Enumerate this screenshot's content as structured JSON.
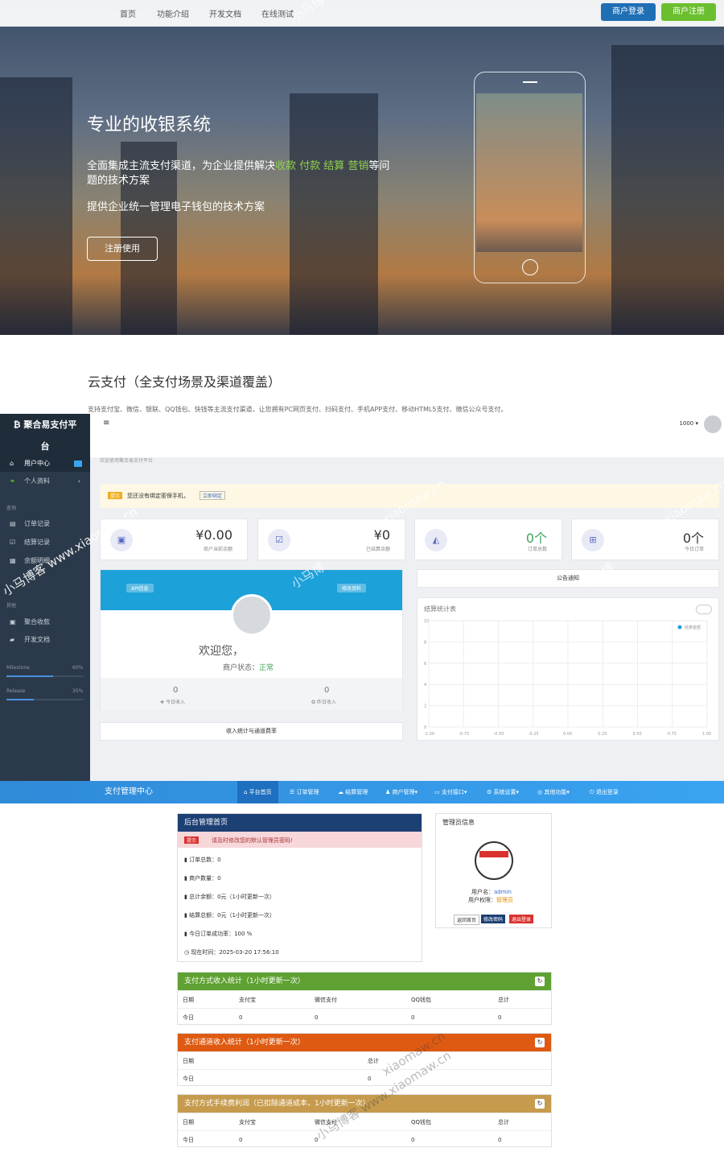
{
  "topnav": {
    "items": [
      "首页",
      "功能介绍",
      "开发文档",
      "在线测试"
    ],
    "login": "商户登录",
    "register": "商户注册"
  },
  "hero": {
    "title": "专业的收银系统",
    "line1_pre": "全面集成主流支付渠道，为企业提供解决",
    "line1_hl": "收款 付款 结算 营销",
    "line1_post": "等问",
    "line2": "题的技术方案",
    "line3": "提供企业统一管理电子钱包的技术方案",
    "cta": "注册使用"
  },
  "section2": {
    "title": "云支付（全支付场景及渠道覆盖）",
    "desc": "支持支付宝、微信、银联、QQ钱包、快钱等主流支付渠道，让您拥有PC网页支付、扫码支付、手机APP支付、移动HTML5支付、微信公众号支付。"
  },
  "watermark": {
    "text1": "小马博客 www.xiaomaw.cn",
    "text2": "小马博",
    "text3": "xiaomaw.cn"
  },
  "dashboard": {
    "brand1": "₿ 聚合易支付平",
    "brand2": "台",
    "sidebar": {
      "user_center": "用户中心",
      "profile": "个人资料",
      "group1": "查询",
      "orders": "订单记录",
      "settle": "结算记录",
      "balance": "余额明细",
      "group2": "其他",
      "collect": "聚合收款",
      "docs": "开发文档",
      "milestone": "Milestone",
      "milestone_pct": "60%",
      "release": "Release",
      "release_pct": "35%",
      "milestone_val": 0.6,
      "release_val": 0.35
    },
    "header": {
      "user": "1000 ▾",
      "breadcrumb": "欢迎使用聚合易支付平台"
    },
    "notice": {
      "tag": "提示",
      "text": "您还没有绑定密保手机，",
      "link": "立即绑定"
    },
    "stats": [
      {
        "value": "¥0.00",
        "label": "商户当前余额"
      },
      {
        "value": "¥0",
        "label": "已结算余额"
      },
      {
        "value": "0个",
        "label": "订单总数"
      },
      {
        "value": "0个",
        "label": "今日订单"
      }
    ],
    "profile": {
      "api": "API信息",
      "edit": "修改资料",
      "welcome": "欢迎您，",
      "status_label": "商户状态：",
      "status": "正常",
      "today_income": "0",
      "today_label": "今日收入",
      "yesterday_income": "0",
      "yesterday_label": "昨日收入",
      "footer": "收入统计与通道费率"
    },
    "announce": "公告通知",
    "chart": {
      "title": "结算统计表",
      "legend": "结算金额",
      "yticks": [
        "10",
        "8",
        "6",
        "4",
        "2",
        "0"
      ],
      "xticks": [
        "-1.00",
        "-0.75",
        "-0.50",
        "-0.25",
        "0.00",
        "0.25",
        "0.50",
        "0.75",
        "1.00"
      ]
    }
  },
  "admin": {
    "title": "支付管理中心",
    "menu": [
      "平台首页",
      "订单管理",
      "结算管理",
      "商户管理▾",
      "支付接口▾",
      "系统设置▾",
      "其他功能▾",
      "退出登录"
    ],
    "home_title": "后台管理首页",
    "warn_tag": "提示",
    "warn_text": "请及时修改您的默认管理员密码!",
    "info": [
      {
        "label": "订单总数：",
        "value": "0"
      },
      {
        "label": "商户数量：",
        "value": "0"
      },
      {
        "label": "总计余额：",
        "value": "0元（1小时更新一次）"
      },
      {
        "label": "结算总额：",
        "value": "0元（1小时更新一次）"
      },
      {
        "label": "今日订单成功率：",
        "value": "100 %"
      },
      {
        "label": "现在时间：",
        "value": "2025-03-20 17:56:10"
      }
    ],
    "mgr": {
      "title": "管理员信息",
      "username_label": "用户名：",
      "username": "admin",
      "role_label": "用户权限：",
      "role": "管理员",
      "b1": "返回首页",
      "b2": "修改密码",
      "b3": "退出登录"
    },
    "t1": {
      "title": "支付方式收入统计（1小时更新一次）",
      "headers": [
        "日期",
        "支付宝",
        "微信支付",
        "QQ钱包",
        "总计"
      ],
      "row": [
        "今日",
        "0",
        "0",
        "0",
        "0"
      ]
    },
    "t2": {
      "title": "支付通道收入统计（1小时更新一次）",
      "headers": [
        "日期",
        "总计"
      ],
      "row": [
        "今日",
        "0"
      ]
    },
    "t3": {
      "title": "支付方式手续费利润（已扣除通道成本，1小时更新一次）",
      "headers": [
        "日期",
        "支付宝",
        "微信支付",
        "QQ钱包",
        "总计"
      ],
      "row": [
        "今日",
        "0",
        "0",
        "0",
        "0"
      ]
    }
  }
}
